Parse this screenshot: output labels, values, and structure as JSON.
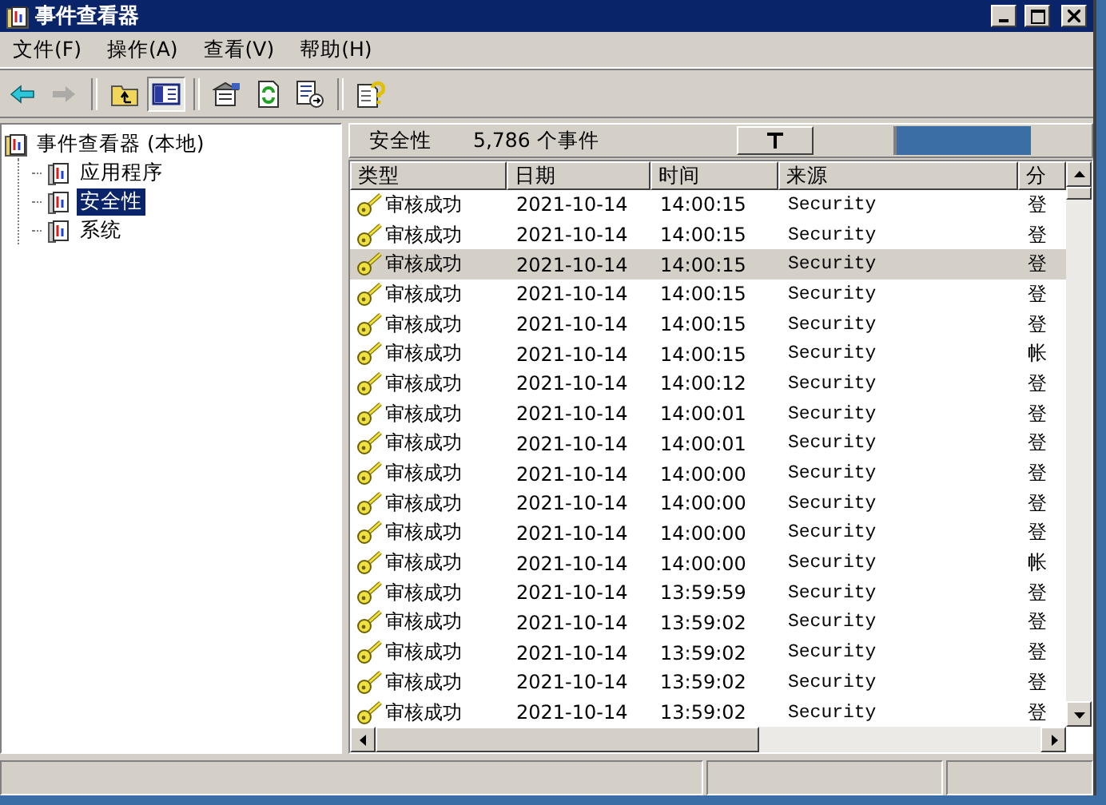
{
  "window": {
    "title": "事件查看器"
  },
  "menu": [
    {
      "label": "文件(F)"
    },
    {
      "label": "操作(A)"
    },
    {
      "label": "查看(V)"
    },
    {
      "label": "帮助(H)"
    }
  ],
  "toolbar": [
    [
      {
        "kind": "back",
        "disabled": false,
        "pressed": false
      },
      {
        "kind": "forward",
        "disabled": true,
        "pressed": false
      }
    ],
    [
      {
        "kind": "up",
        "disabled": false,
        "pressed": false
      },
      {
        "kind": "tree",
        "disabled": false,
        "pressed": true
      }
    ],
    [
      {
        "kind": "properties",
        "disabled": false,
        "pressed": false
      },
      {
        "kind": "refresh",
        "disabled": false,
        "pressed": false
      },
      {
        "kind": "export",
        "disabled": false,
        "pressed": false
      }
    ],
    [
      {
        "kind": "help",
        "disabled": false,
        "pressed": false
      }
    ]
  ],
  "tree": {
    "label": "事件查看器 (本地)",
    "selected": false,
    "children": [
      {
        "label": "应用程序",
        "selected": false
      },
      {
        "label": "安全性",
        "selected": true
      },
      {
        "label": "系统",
        "selected": false
      }
    ]
  },
  "list_header": {
    "title": "安全性",
    "count": "5,786 个事件"
  },
  "table": {
    "columns": [
      "类型",
      "日期",
      "时间",
      "来源",
      "分"
    ],
    "rows": [
      {
        "cells": [
          "审核成功",
          "2021-10-14",
          "14:00:15",
          "Security",
          "登"
        ],
        "selected": false
      },
      {
        "cells": [
          "审核成功",
          "2021-10-14",
          "14:00:15",
          "Security",
          "登"
        ],
        "selected": false
      },
      {
        "cells": [
          "审核成功",
          "2021-10-14",
          "14:00:15",
          "Security",
          "登"
        ],
        "selected": true
      },
      {
        "cells": [
          "审核成功",
          "2021-10-14",
          "14:00:15",
          "Security",
          "登"
        ],
        "selected": false
      },
      {
        "cells": [
          "审核成功",
          "2021-10-14",
          "14:00:15",
          "Security",
          "登"
        ],
        "selected": false
      },
      {
        "cells": [
          "审核成功",
          "2021-10-14",
          "14:00:15",
          "Security",
          "帐"
        ],
        "selected": false
      },
      {
        "cells": [
          "审核成功",
          "2021-10-14",
          "14:00:12",
          "Security",
          "登"
        ],
        "selected": false
      },
      {
        "cells": [
          "审核成功",
          "2021-10-14",
          "14:00:01",
          "Security",
          "登"
        ],
        "selected": false
      },
      {
        "cells": [
          "审核成功",
          "2021-10-14",
          "14:00:01",
          "Security",
          "登"
        ],
        "selected": false
      },
      {
        "cells": [
          "审核成功",
          "2021-10-14",
          "14:00:00",
          "Security",
          "登"
        ],
        "selected": false
      },
      {
        "cells": [
          "审核成功",
          "2021-10-14",
          "14:00:00",
          "Security",
          "登"
        ],
        "selected": false
      },
      {
        "cells": [
          "审核成功",
          "2021-10-14",
          "14:00:00",
          "Security",
          "登"
        ],
        "selected": false
      },
      {
        "cells": [
          "审核成功",
          "2021-10-14",
          "14:00:00",
          "Security",
          "帐"
        ],
        "selected": false
      },
      {
        "cells": [
          "审核成功",
          "2021-10-14",
          "13:59:59",
          "Security",
          "登"
        ],
        "selected": false
      },
      {
        "cells": [
          "审核成功",
          "2021-10-14",
          "13:59:02",
          "Security",
          "登"
        ],
        "selected": false
      },
      {
        "cells": [
          "审核成功",
          "2021-10-14",
          "13:59:02",
          "Security",
          "登"
        ],
        "selected": false
      },
      {
        "cells": [
          "审核成功",
          "2021-10-14",
          "13:59:02",
          "Security",
          "登"
        ],
        "selected": false
      },
      {
        "cells": [
          "审核成功",
          "2021-10-14",
          "13:59:02",
          "Security",
          "登"
        ],
        "selected": false
      }
    ]
  }
}
